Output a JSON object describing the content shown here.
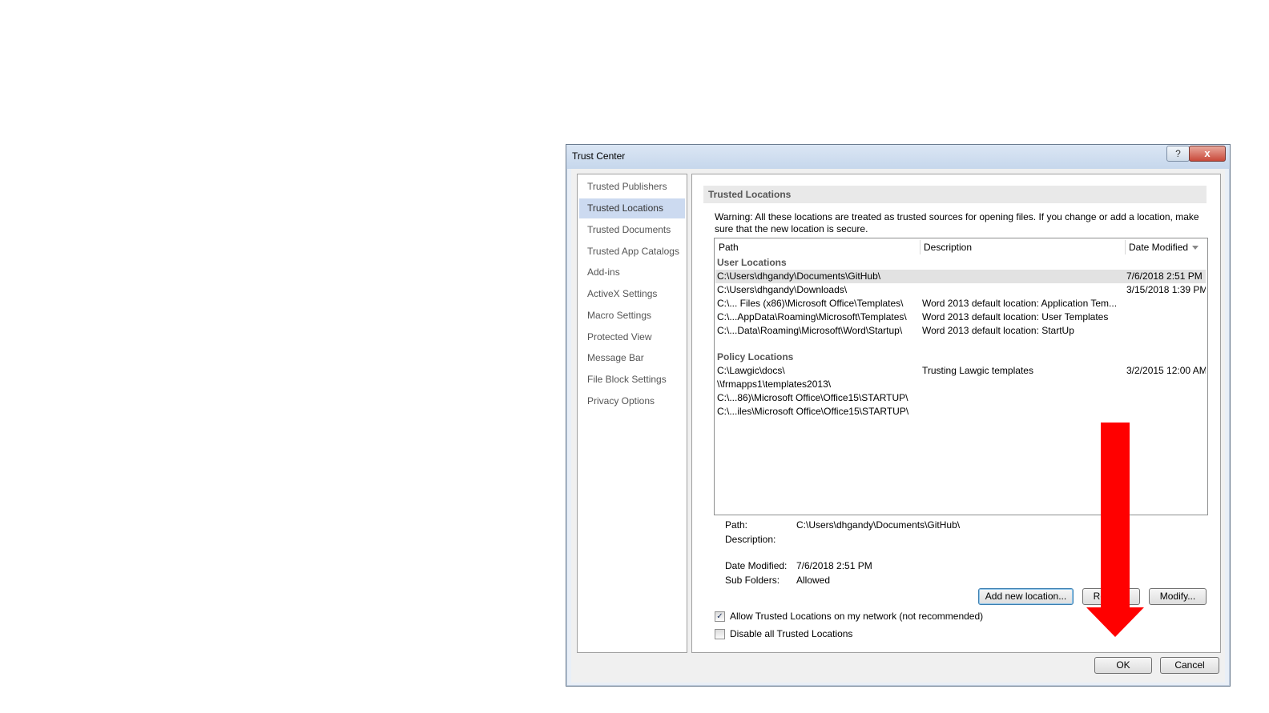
{
  "dialog": {
    "title": "Trust Center",
    "help_label": "?",
    "close_label": "x"
  },
  "nav": {
    "items": [
      {
        "label": "Trusted Publishers"
      },
      {
        "label": "Trusted Locations"
      },
      {
        "label": "Trusted Documents"
      },
      {
        "label": "Trusted App Catalogs"
      },
      {
        "label": "Add-ins"
      },
      {
        "label": "ActiveX Settings"
      },
      {
        "label": "Macro Settings"
      },
      {
        "label": "Protected View"
      },
      {
        "label": "Message Bar"
      },
      {
        "label": "File Block Settings"
      },
      {
        "label": "Privacy Options"
      }
    ],
    "selected_index": 1
  },
  "main": {
    "section_title": "Trusted Locations",
    "warning": "Warning: All these locations are treated as trusted sources for opening files.  If you change or add a location, make sure that the new location is secure.",
    "columns": {
      "path": "Path",
      "description": "Description",
      "date_modified": "Date Modified"
    },
    "user_group": "User Locations",
    "user_rows": [
      {
        "path": "C:\\Users\\dhgandy\\Documents\\GitHub\\",
        "description": "",
        "date": "7/6/2018 2:51 PM"
      },
      {
        "path": "C:\\Users\\dhgandy\\Downloads\\",
        "description": "",
        "date": "3/15/2018 1:39 PM"
      },
      {
        "path": "C:\\... Files (x86)\\Microsoft Office\\Templates\\",
        "description": "Word 2013 default location: Application Tem...",
        "date": ""
      },
      {
        "path": "C:\\...AppData\\Roaming\\Microsoft\\Templates\\",
        "description": "Word 2013 default location: User Templates",
        "date": ""
      },
      {
        "path": "C:\\...Data\\Roaming\\Microsoft\\Word\\Startup\\",
        "description": "Word 2013 default location: StartUp",
        "date": ""
      }
    ],
    "policy_group": "Policy Locations",
    "policy_rows": [
      {
        "path": "C:\\Lawgic\\docs\\",
        "description": "Trusting Lawgic templates",
        "date": "3/2/2015 12:00 AM"
      },
      {
        "path": "\\\\frmapps1\\templates2013\\",
        "description": "",
        "date": ""
      },
      {
        "path": "C:\\...86)\\Microsoft Office\\Office15\\STARTUP\\",
        "description": "",
        "date": ""
      },
      {
        "path": "C:\\...iles\\Microsoft Office\\Office15\\STARTUP\\",
        "description": "",
        "date": ""
      }
    ],
    "details": {
      "path_label": "Path:",
      "path_value": "C:\\Users\\dhgandy\\Documents\\GitHub\\",
      "description_label": "Description:",
      "description_value": "",
      "date_label": "Date Modified:",
      "date_value": "7/6/2018 2:51 PM",
      "subfolders_label": "Sub Folders:",
      "subfolders_value": "Allowed"
    },
    "buttons": {
      "add": "Add new location...",
      "remove": "Remove",
      "modify": "Modify..."
    },
    "checkboxes": {
      "allow_network": {
        "label": "Allow Trusted Locations on my network (not recommended)",
        "checked": true
      },
      "disable_all": {
        "label": "Disable all Trusted Locations",
        "checked": false
      }
    }
  },
  "footer": {
    "ok": "OK",
    "cancel": "Cancel"
  },
  "annotation": {
    "arrow_color": "#ff0000"
  }
}
